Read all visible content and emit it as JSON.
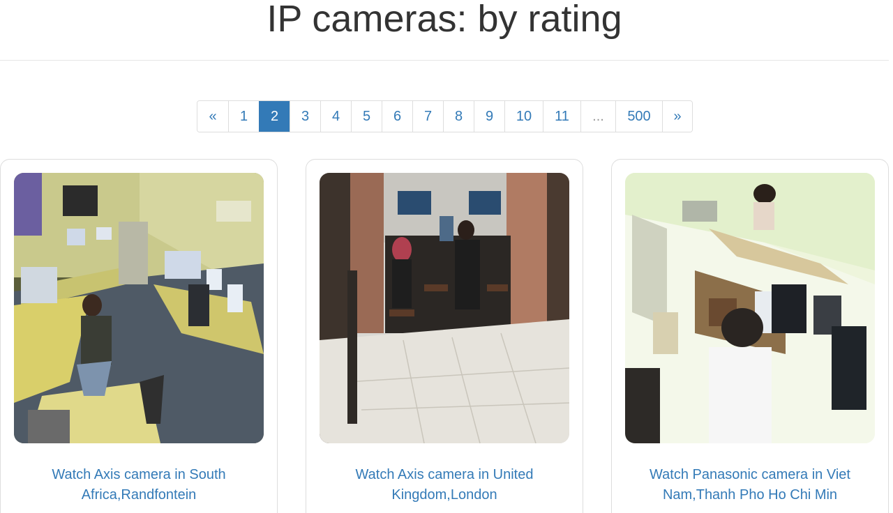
{
  "page_title": "IP cameras: by rating",
  "pagination": {
    "prev": "«",
    "next": "»",
    "pages": [
      "1",
      "2",
      "3",
      "4",
      "5",
      "6",
      "7",
      "8",
      "9",
      "10",
      "11",
      "...",
      "500"
    ],
    "active": "2"
  },
  "cameras": [
    {
      "caption": "Watch Axis camera in South Africa,Randfontein",
      "scene": "office-control-room"
    },
    {
      "caption": "Watch Axis camera in United Kingdom,London",
      "scene": "cafe-bar-interior"
    },
    {
      "caption": "Watch Panasonic camera in Viet Nam,Thanh Pho Ho Chi Min",
      "scene": "shop-counter"
    }
  ],
  "colors": {
    "link": "#337ab7",
    "active_bg": "#337ab7",
    "border": "#dddddd",
    "title": "#333333"
  }
}
